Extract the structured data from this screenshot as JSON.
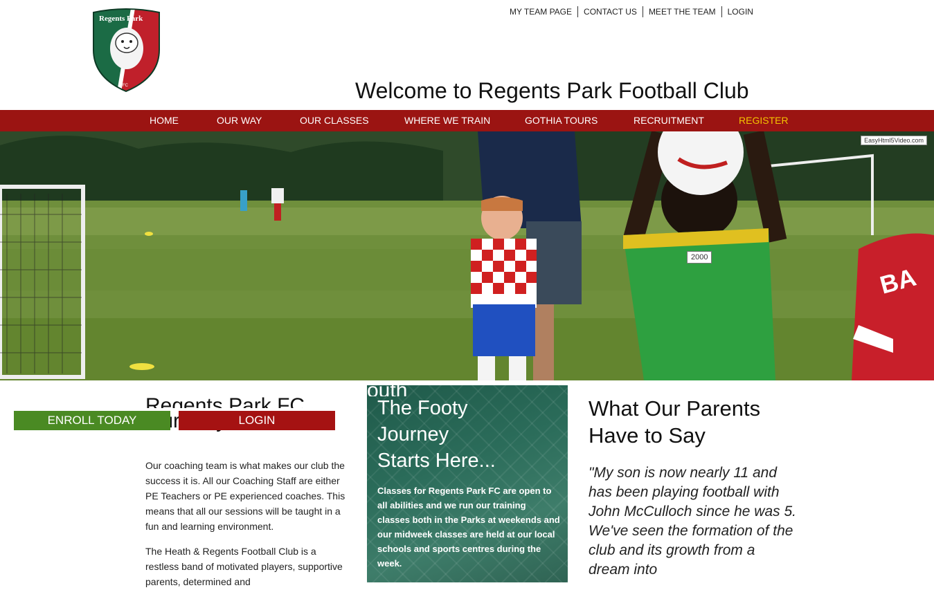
{
  "header": {
    "logo_text_top": "Regents Park",
    "logo_text_bottom": "FC",
    "top_links": [
      "MY TEAM PAGE",
      "CONTACT US",
      "MEET THE TEAM",
      "LOGIN"
    ],
    "welcome": "Welcome to Regents Park Football Club"
  },
  "nav": {
    "items": [
      "HOME",
      "OUR WAY",
      "OUR CLASSES",
      "WHERE WE TRAIN",
      "GOTHIA TOURS",
      "RECRUITMENT",
      "REGISTER"
    ]
  },
  "hero": {
    "watermark": "EasyHtml5Video.com",
    "tooltip": "2000",
    "shirt_text": "BA"
  },
  "buttons": {
    "enroll": "ENROLL TODAY",
    "login": "LOGIN"
  },
  "our_way": {
    "title_line1": "Regents Park FC",
    "title_line2": "Our Way",
    "para1": "Our coaching team is what makes our club the success it is. All our Coaching Staff are either PE Teachers or PE experienced coaches. This means that all our sessions will be taught in a fun and learning environment.",
    "para2": "The Heath & Regents Football Club is a restless band of motivated players, supportive parents, determined and"
  },
  "footy": {
    "ghost": "outh",
    "title": "The Footy Journey Starts Here...",
    "body": "Classes for Regents Park FC are open to all abilities and we run our training classes both in the Parks at weekends and our midweek classes are held at our local schools and sports centres during the week."
  },
  "parents": {
    "title": "What Our Parents Have to Say",
    "quote": "\"My son is now nearly 11 and has been playing football with John McCulloch since he was 5. We've seen the formation of the club and its growth from a dream into"
  },
  "colors": {
    "nav_bg": "#9b1412",
    "register": "#f4c400",
    "enroll": "#4a8a23",
    "login": "#a51212",
    "panel": "#2b6c5a"
  }
}
